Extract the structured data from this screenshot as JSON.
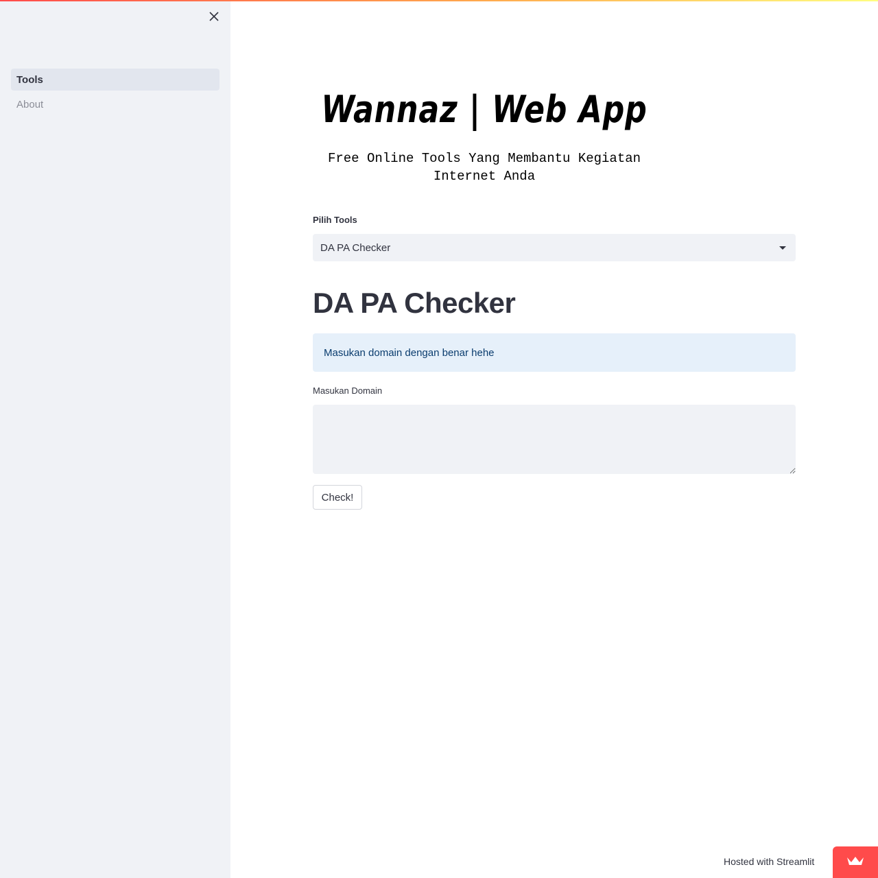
{
  "sidebar": {
    "close_icon": "close-icon",
    "items": [
      {
        "label": "Tools",
        "active": true
      },
      {
        "label": "About",
        "active": false
      }
    ]
  },
  "main": {
    "app_title": "Wannaz | Web App",
    "app_subtitle": "Free Online Tools Yang Membantu Kegiatan Internet Anda",
    "tool_select": {
      "label": "Pilih Tools",
      "selected": "DA PA Checker"
    },
    "section_title": "DA PA Checker",
    "info_message": "Masukan domain dengan benar hehe",
    "domain_input": {
      "label": "Masukan Domain",
      "value": ""
    },
    "check_button": "Check!"
  },
  "footer": {
    "hosted_text": "Hosted with Streamlit",
    "badge_icon": "crown-icon"
  },
  "colors": {
    "accent": "#ff4b4b",
    "sidebar_bg": "#f0f2f6",
    "info_bg": "#e6f0fa",
    "info_text": "#0a3c6e",
    "text": "#31333f"
  }
}
